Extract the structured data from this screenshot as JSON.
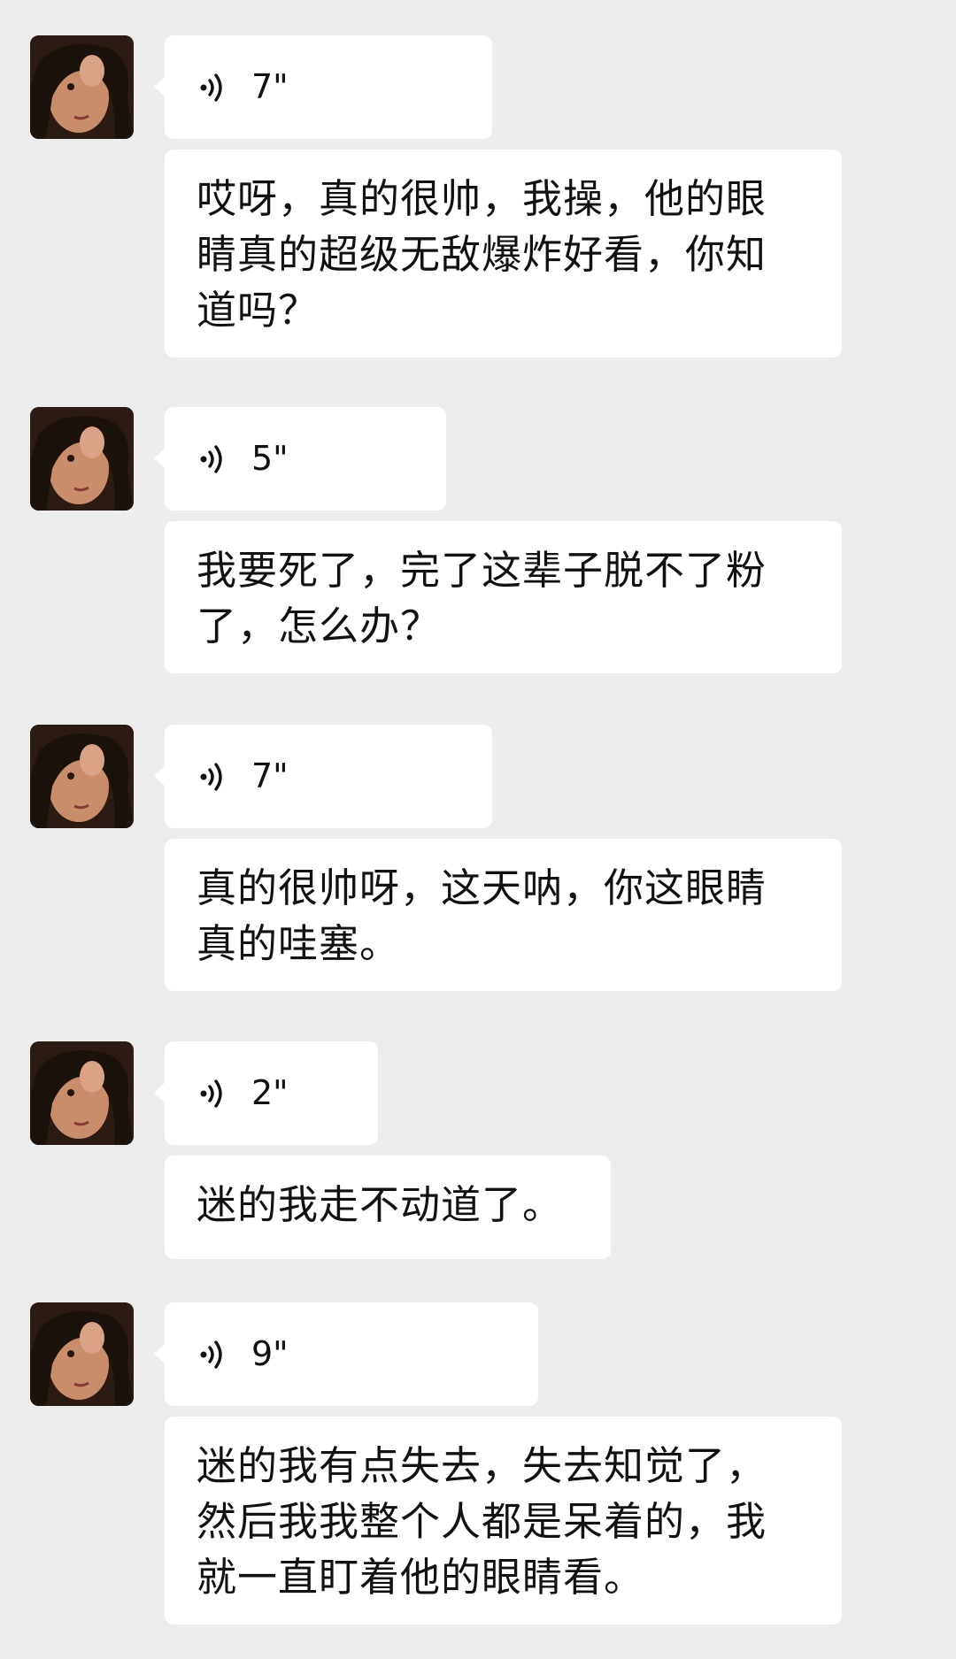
{
  "messages": [
    {
      "duration": "7\"",
      "lines": [
        "哎呀，真的很帅，我操，他的眼",
        "睛真的超级无敌爆炸好看，你知",
        "道吗？"
      ]
    },
    {
      "duration": "5\"",
      "lines": [
        "我要死了，完了这辈子脱不了粉",
        "了，怎么办？"
      ]
    },
    {
      "duration": "7\"",
      "lines": [
        "真的很帅呀，这天呐，你这眼睛",
        "真的哇塞。"
      ]
    },
    {
      "duration": "2\"",
      "lines": [
        "迷的我走不动道了。"
      ]
    },
    {
      "duration": "9\"",
      "lines": [
        "迷的我有点失去，失去知觉了，",
        "然后我我整个人都是呆着的，我",
        "就一直盯着他的眼睛看。"
      ]
    }
  ],
  "colors": {
    "background": "#ededed",
    "bubble": "#ffffff",
    "text": "#111111"
  },
  "icons": {
    "voice": "voice-wave-icon",
    "avatar": "user-avatar"
  }
}
